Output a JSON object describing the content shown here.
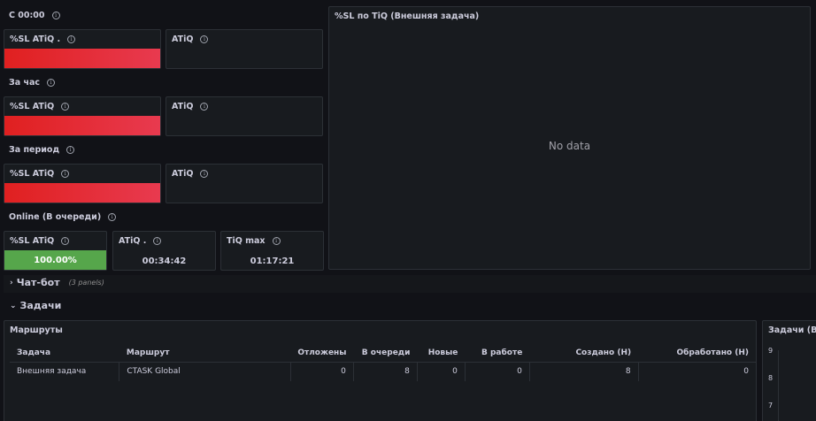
{
  "section_today": {
    "label": "С 00:00"
  },
  "section_hour": {
    "label": "За час"
  },
  "section_period": {
    "label": "За период"
  },
  "section_online": {
    "label": "Online (В очереди)"
  },
  "stats": {
    "today_sl": "%SL ATiQ .",
    "today_atiq": "ATiQ",
    "hour_sl": "%SL ATiQ",
    "hour_atiq": "ATiQ",
    "period_sl": "%SL ATiQ",
    "period_atiq": "ATiQ",
    "online_sl": "%SL ATiQ",
    "online_sl_value": "100.00%",
    "online_atiq": "ATiQ .",
    "online_atiq_value": "00:34:42",
    "online_tiqmax": "TiQ max",
    "online_tiqmax_value": "01:17:21"
  },
  "sl_panel": {
    "title": "%SL по TiQ (Внешняя задача)",
    "empty_text": "No data"
  },
  "rows": {
    "chatbot": {
      "label": "Чат-бот",
      "sub": "(3 panels)"
    },
    "tasks": {
      "label": "Задачи"
    }
  },
  "routes": {
    "title": "Маршруты",
    "columns": [
      "Задача",
      "Маршрут",
      "Отложены",
      "В очереди",
      "Новые",
      "В работе",
      "Создано (Н)",
      "Обработано (Н)"
    ],
    "rows": [
      [
        "Внешняя задача",
        "CTASK Global",
        "0",
        "8",
        "0",
        "0",
        "8",
        "0"
      ]
    ]
  },
  "tasks_chart": {
    "title": "Задачи (Вне",
    "yticks": [
      "9",
      "8",
      "7"
    ]
  },
  "colors": {
    "red": "#e02020",
    "green": "#56a64b",
    "panel": "#181b1f",
    "background": "#111217"
  },
  "icons": {
    "info": "info-icon",
    "chevron_right": "chevron-right-icon",
    "chevron_down": "chevron-down-icon"
  }
}
